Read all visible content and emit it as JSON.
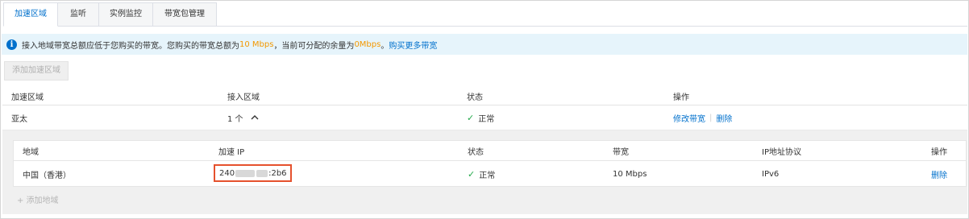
{
  "tabs": [
    {
      "label": "加速区域",
      "active": true
    },
    {
      "label": "监听",
      "active": false
    },
    {
      "label": "实例监控",
      "active": false
    },
    {
      "label": "带宽包管理",
      "active": false
    }
  ],
  "notice": {
    "icon": "info-circle-icon",
    "text_1": "接入地域带宽总额应低于您购买的带宽。您购买的带宽总额为",
    "purchased_bw": "10 Mbps",
    "text_2": "，当前可分配的余量为",
    "remaining_bw": "0Mbps",
    "text_3": "。",
    "link": "购买更多带宽"
  },
  "add_region_button": "添加加速区域",
  "region_table": {
    "headers": [
      "加速区域",
      "接入区域",
      "状态",
      "操作"
    ],
    "rows": [
      {
        "region": "亚太",
        "access_count": "1 个",
        "status": "正常",
        "actions": [
          "修改带宽",
          "删除"
        ]
      }
    ]
  },
  "access_table": {
    "headers": [
      "地域",
      "加速 IP",
      "状态",
      "带宽",
      "IP地址协议",
      "操作"
    ],
    "rows": [
      {
        "area": "中国（香港）",
        "ip_prefix": "240",
        "ip_suffix": ":2b6",
        "status": "正常",
        "bandwidth": "10 Mbps",
        "protocol": "IPv6",
        "action": "删除"
      }
    ]
  },
  "add_access_area": "添加地域",
  "colors": {
    "accent": "#0070cc",
    "highlight": "#f39800",
    "success": "#23a94a",
    "annotation_box": "#e5512d",
    "notice_bg": "#e6f4fb"
  }
}
